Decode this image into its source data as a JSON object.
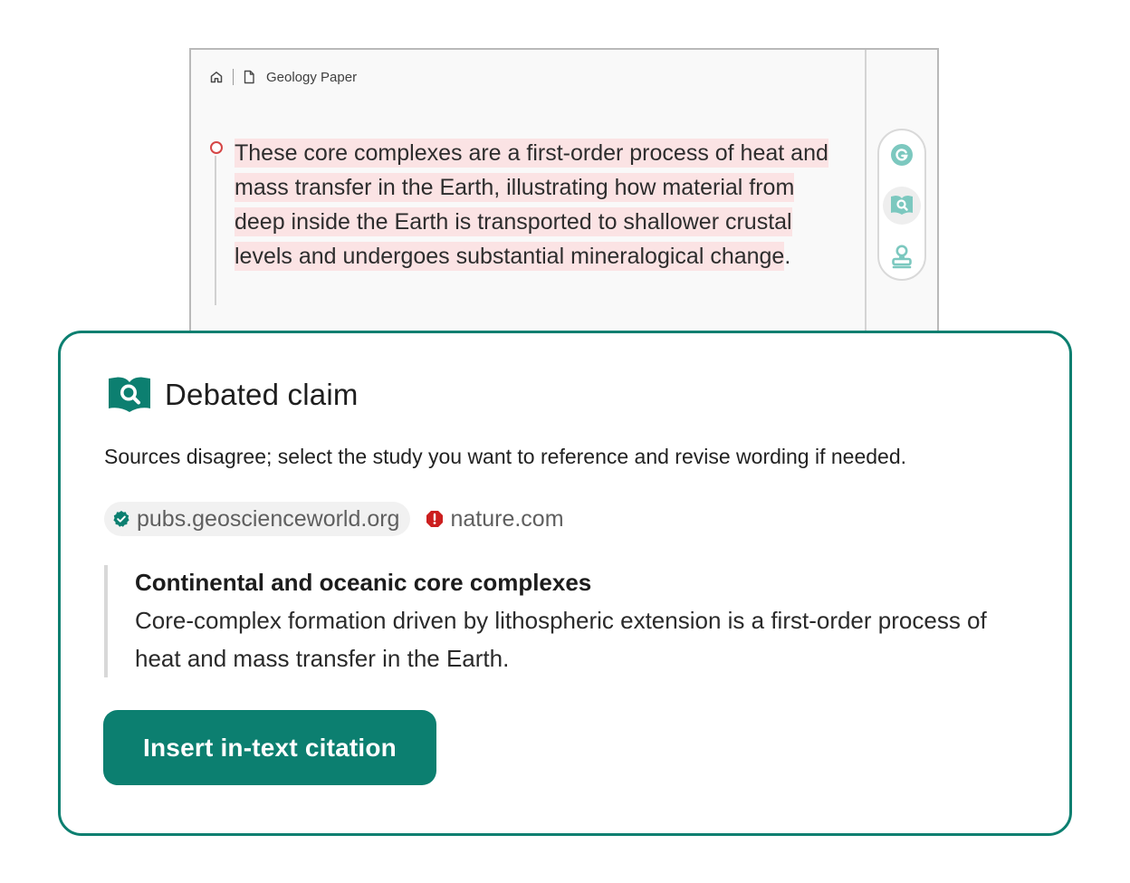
{
  "breadcrumb": {
    "home_icon": "home-icon",
    "doc_icon": "document-icon",
    "title": "Geology Paper"
  },
  "passage": {
    "highlighted_text": "These core complexes are a first-order process of heat and mass transfer in the Earth, illustrating how material from deep inside the Earth is transported to shallower crustal levels and undergoes substantial mineralogical change",
    "trailing_text": "."
  },
  "tool_rail": {
    "items": [
      {
        "icon": "grammarly-icon",
        "active": false
      },
      {
        "icon": "book-search-icon",
        "active": true
      },
      {
        "icon": "stamp-icon",
        "active": false
      }
    ]
  },
  "card": {
    "icon": "book-search-icon",
    "title": "Debated claim",
    "description": "Sources disagree; select the study you want to reference and revise wording if needed.",
    "sources": [
      {
        "label": "pubs.geoscienceworld.org",
        "status": "verified",
        "icon": "verified-check-icon",
        "selected": true
      },
      {
        "label": "nature.com",
        "status": "warning",
        "icon": "alert-icon",
        "selected": false
      }
    ],
    "quote": {
      "title": "Continental and oceanic core complexes",
      "body": "Core-complex formation driven by lithospheric extension is a first-order process of heat and mass transfer in the Earth."
    },
    "primary_button": "Insert in-text citation"
  },
  "colors": {
    "accent": "#0c7f70",
    "highlight": "#fbe3e4",
    "warning": "#cc1f1f",
    "icon_teal": "#7cc8bf"
  }
}
